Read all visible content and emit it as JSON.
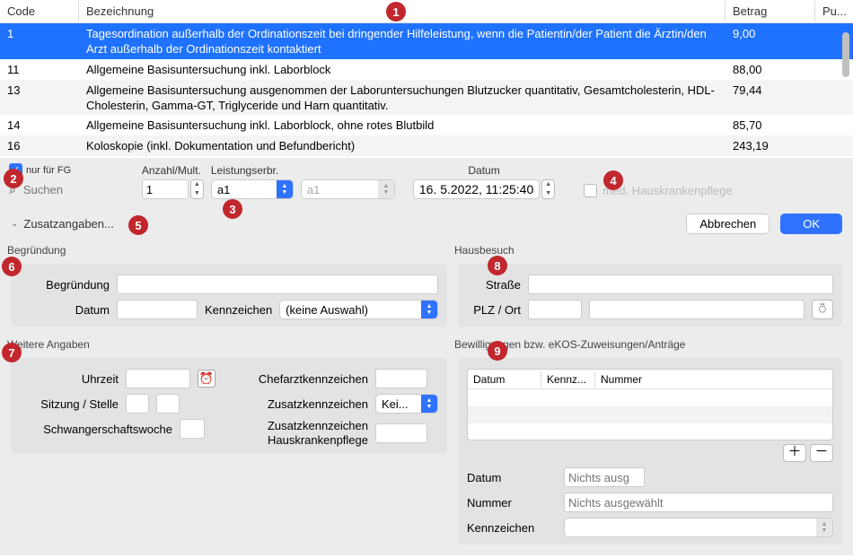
{
  "table": {
    "headers": {
      "code": "Code",
      "bez": "Bezeichnung",
      "betrag": "Betrag",
      "pu": "Pu..."
    },
    "rows": [
      {
        "code": "1",
        "bez": "Tagesordination außerhalb der Ordinationszeit bei dringender Hilfeleistung, wenn die Patientin/der Patient die Ärztin/den Arzt außerhalb der Ordinationszeit kontaktiert",
        "betrag": "9,00",
        "selected": true
      },
      {
        "code": "11",
        "bez": "Allgemeine Basisuntersuchung inkl. Laborblock",
        "betrag": "88,00"
      },
      {
        "code": "13",
        "bez": "Allgemeine Basisuntersuchung ausgenommen der Laboruntersuchungen Blutzucker quantitativ, Gesamtcholesterin, HDL-Cholesterin, Gamma-GT, Triglyceride und Harn quantitativ.",
        "betrag": "79,44",
        "alt": true
      },
      {
        "code": "14",
        "bez": "Allgemeine Basisuntersuchung inkl. Laborblock, ohne rotes Blutbild",
        "betrag": "85,70"
      },
      {
        "code": "16",
        "bez": "Koloskopie (inkl. Dokumentation und Befundbericht)",
        "betrag": "243,19",
        "alt": true
      }
    ]
  },
  "filter": {
    "nur_fg_label": "nur für FG",
    "search_placeholder": "Suchen",
    "anzahl_label": "Anzahl/Mult.",
    "anzahl_value": "1",
    "leist_label": "Leistungserbr.",
    "leist1_value": "a1",
    "leist2_value": "a1",
    "datum_label": "Datum",
    "datum_value": "16.  5.2022, 11:25:40",
    "med_hkp_label": "med. Hauskrankenpflege"
  },
  "zusatz_toggle": "Zusatzangaben...",
  "buttons": {
    "cancel": "Abbrechen",
    "ok": "OK"
  },
  "begr": {
    "section": "Begründung",
    "label_begr": "Begründung",
    "label_datum": "Datum",
    "label_kennz": "Kennzeichen",
    "kennz_value": "(keine Auswahl)"
  },
  "weitere": {
    "section": "Weitere Angaben",
    "uhrzeit": "Uhrzeit",
    "sitzung": "Sitzung / Stelle",
    "ssw": "Schwangerschaftswoche",
    "chefarzt": "Chefarztkennzeichen",
    "zusatzk": "Zusatzkennzeichen",
    "zusatzk_value": "Kei...",
    "zusatz_hkp1": "Zusatzkennzeichen",
    "zusatz_hkp2": "Hauskrankenpflege"
  },
  "haus": {
    "section": "Hausbesuch",
    "strasse": "Straße",
    "plz_ort": "PLZ / Ort"
  },
  "bew": {
    "section": "Bewilligungen bzw. eKOS-Zuweisungen/Anträge",
    "col_datum": "Datum",
    "col_kennz": "Kennz...",
    "col_nummer": "Nummer",
    "f_datum": "Datum",
    "f_datum_ph": "Nichts ausg",
    "f_nummer": "Nummer",
    "f_nummer_ph": "Nichts ausgewählt",
    "f_kennz": "Kennzeichen"
  },
  "annotations": [
    "1",
    "2",
    "3",
    "4",
    "5",
    "6",
    "7",
    "8",
    "9"
  ]
}
